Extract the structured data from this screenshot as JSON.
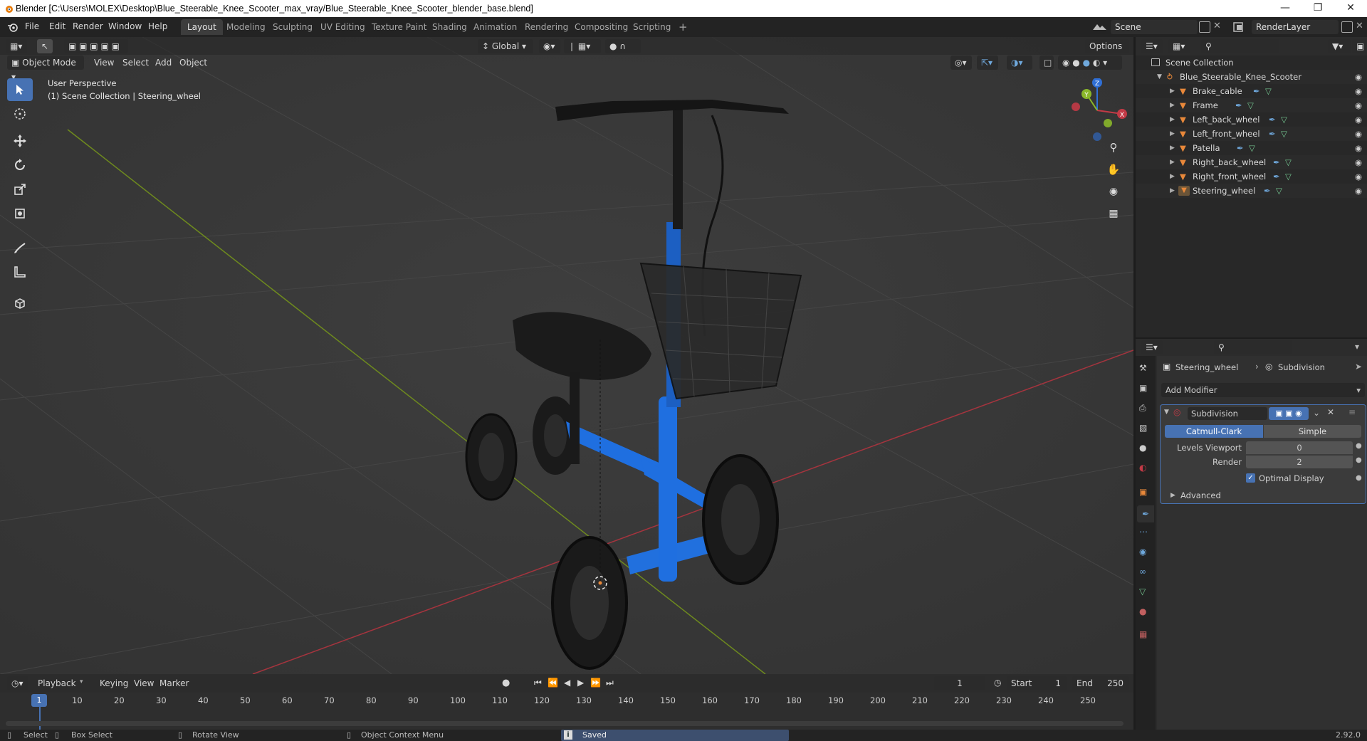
{
  "window": {
    "title": "Blender [C:\\Users\\MOLEX\\Desktop\\Blue_Steerable_Knee_Scooter_max_vray/Blue_Steerable_Knee_Scooter_blender_base.blend]"
  },
  "menu": {
    "items": [
      "File",
      "Edit",
      "Render",
      "Window",
      "Help"
    ]
  },
  "workspaces": {
    "tabs": [
      "Layout",
      "Modeling",
      "Sculpting",
      "UV Editing",
      "Texture Paint",
      "Shading",
      "Animation",
      "Rendering",
      "Compositing",
      "Scripting"
    ],
    "add": "+"
  },
  "scene": {
    "name": "Scene"
  },
  "renderlayer": {
    "name": "RenderLayer"
  },
  "viewport_header": {
    "transform_orientation": "Global",
    "options": "Options",
    "mode": "Object Mode",
    "menus": [
      "View",
      "Select",
      "Add",
      "Object"
    ]
  },
  "viewport": {
    "perspective_label": "User Perspective",
    "collection_label": "(1) Scene Collection | Steering_wheel",
    "gizmo": {
      "x": "X",
      "y": "Y",
      "z": "Z"
    }
  },
  "outliner": {
    "root": "Scene Collection",
    "collection": "Blue_Steerable_Knee_Scooter",
    "objects": [
      "Brake_cable",
      "Frame",
      "Left_back_wheel",
      "Left_front_wheel",
      "Patella",
      "Right_back_wheel",
      "Right_front_wheel",
      "Steering_wheel"
    ]
  },
  "properties": {
    "object_name": "Steering_wheel",
    "modifier_context": "Subdivision",
    "add_modifier": "Add Modifier",
    "modifier": {
      "name": "Subdivision",
      "type_catmull": "Catmull-Clark",
      "type_simple": "Simple",
      "levels_viewport_label": "Levels Viewport",
      "levels_viewport": "0",
      "render_label": "Render",
      "render": "2",
      "optimal_display": "Optimal Display",
      "advanced": "Advanced"
    }
  },
  "timeline": {
    "menus": [
      "Playback",
      "Keying",
      "View",
      "Marker"
    ],
    "current_frame": "1",
    "start_label": "Start",
    "start": "1",
    "end_label": "End",
    "end": "250",
    "ruler_ticks": [
      "10",
      "20",
      "30",
      "40",
      "50",
      "60",
      "70",
      "80",
      "90",
      "100",
      "110",
      "120",
      "130",
      "140",
      "150",
      "160",
      "170",
      "180",
      "190",
      "200",
      "210",
      "220",
      "230",
      "240",
      "250"
    ],
    "playhead": "1"
  },
  "statusbar": {
    "select": "Select",
    "box_select": "Box Select",
    "rotate_view": "Rotate View",
    "context_menu": "Object Context Menu",
    "message": "Saved \"Blue_Steerable_Knee_Scooter_blender_base.blend\"",
    "version": "2.92.0"
  },
  "colors": {
    "accent": "#4772b3",
    "object_orange": "#e8883a",
    "modifier_blue": "#6fa8dc",
    "mesh_green": "#73c48f",
    "axis_x": "#c23a46",
    "axis_y": "#8ab72a",
    "axis_z": "#2f6fd6"
  }
}
